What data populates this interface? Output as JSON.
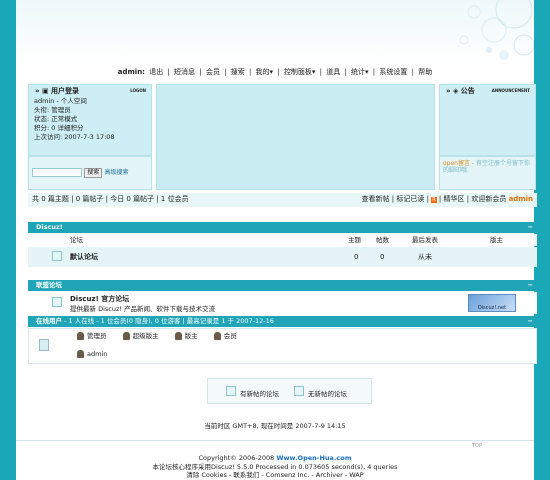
{
  "topnav": {
    "user": "admin:",
    "items": [
      "退出",
      "|",
      "短消息",
      "|",
      "会员",
      "|",
      "搜索",
      "|",
      "我的▾",
      "|",
      "控制面板▾",
      "|",
      "道具",
      "|",
      "统计▾",
      "|",
      "系统设置",
      "|",
      "帮助"
    ]
  },
  "login_panel": {
    "title": "用户登录",
    "title_en": "LOGON",
    "lines": [
      "admin - 个人空间",
      "头衔: 管理员",
      "状态: 正常模式",
      "积分: 0 详细积分",
      "上次访问: 2007-7-3 17:08"
    ],
    "search_button": "搜索",
    "advanced_search": "高级搜索"
  },
  "notice_panel": {
    "title": "公告",
    "title_en": "ANNOUNCEMENT",
    "message_label": "open留言 - ",
    "message": "有空注册个号留下你的脚印哦."
  },
  "stats_bar": {
    "text": "共 0 篇主题 | 0 篇帖子 | 今日 0 篇帖子 | 1 位会员",
    "links": [
      "查看新帖",
      "|",
      "标记已读",
      "|",
      "RSS",
      "|",
      "精华区",
      "|",
      "欢迎新会员"
    ],
    "new_member": "admin"
  },
  "forum_section": {
    "title": "Discuz!",
    "columns": [
      "论坛",
      "主题",
      "帖数",
      "最后发表",
      "版主"
    ],
    "rows": [
      {
        "name": "默认论坛",
        "topics": "0",
        "posts": "0",
        "last": "从未",
        "moderator": ""
      }
    ]
  },
  "partner_section": {
    "title": "联盟论坛",
    "name": "Discuz! 官方论坛",
    "desc": "提供最新 Discuz! 产品新闻、软件下载与技术交流",
    "logo_text": "Discuz!.net"
  },
  "online_section": {
    "title": "在线用户",
    "summary": " - 1 人在线 - 1 位会员(0 隐身), 0 位游客 | 最高记录是 1 于 2007-12-16",
    "legend": [
      "管理员",
      "超级版主",
      "版主",
      "会员"
    ],
    "users": [
      "admin"
    ]
  },
  "legend_box": {
    "new": "有新帖的论坛",
    "none": "无新帖的论坛"
  },
  "timezone": "当前时区 GMT+8, 现在时间是 2007-7-9 14:15",
  "top_link": "TOP",
  "footer": {
    "copyright": "Copyright© 2006-2008 ",
    "site": "Www.Open-Hua.com",
    "powered": "本论坛核心程序采用Discuz! 5.5.0  Processed in 0.073605 second(s), 4 queries",
    "links": "清除 Cookies - 联系我们 - Comsenz Inc. - Archiver - WAP"
  },
  "colors": {
    "background": "#1aa7b7",
    "header_bar": "#1fa4b8",
    "panel": "#cdeef4"
  }
}
